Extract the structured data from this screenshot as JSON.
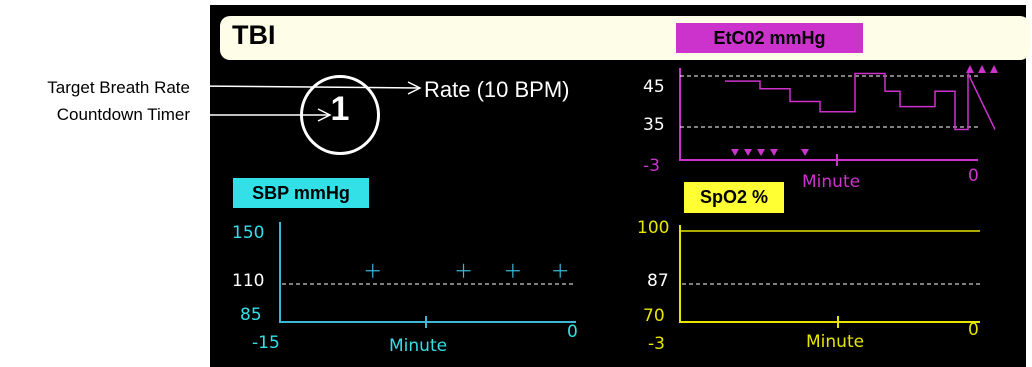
{
  "annotations": {
    "target_breath_rate": "Target Breath Rate",
    "countdown_timer": "Countdown Timer"
  },
  "monitor": {
    "title": "TBI",
    "rate_label": "Rate (10 BPM)",
    "countdown_value": "1"
  },
  "colors": {
    "etco2": "#cc33cc",
    "etco2_badge": "#cc33cc",
    "sbp": "#3cb8d6",
    "sbp_badge": "#33e0e8",
    "spo2": "#e6e600",
    "spo2_badge": "#ffff33",
    "grid": "#ffffff",
    "background": "#000000",
    "header": "#fdfde8"
  },
  "chart_data": [
    {
      "type": "line",
      "title": "EtC02 mmHg",
      "xlabel": "Minute",
      "x_ticks": [
        "-3",
        "0"
      ],
      "y_ticks": [
        "45",
        "35"
      ],
      "reference_lines": [
        45,
        35
      ],
      "series": [
        {
          "x": [
            -2.55,
            -2.2,
            -2.2,
            -1.9,
            -1.9,
            -1.6,
            -1.6,
            -1.25,
            -1.25,
            -0.95,
            -0.95,
            -0.8,
            -0.8,
            -0.45,
            -0.45,
            -0.25,
            -0.25,
            -0.12,
            -0.12,
            0.15
          ],
          "y": [
            44,
            44,
            42.5,
            42.5,
            40,
            40,
            38,
            38,
            45.5,
            45.5,
            42,
            42,
            39,
            39,
            42,
            42,
            34.5,
            34.5,
            45.5,
            34.5
          ]
        }
      ],
      "markers_low_x": [
        -2.45,
        -2.32,
        -2.19,
        -2.06,
        -1.75
      ],
      "markers_high_x": [
        -0.1,
        0.02,
        0.14
      ]
    },
    {
      "type": "scatter",
      "title": "SBP mmHg",
      "xlabel": "Minute",
      "x_ticks": [
        "-15",
        "0"
      ],
      "y_ticks": [
        "150",
        "110",
        "85"
      ],
      "reference_lines": [
        110
      ],
      "series": [
        {
          "x": [
            -10.3,
            -5.7,
            -3.2,
            -0.8
          ],
          "y": [
            119,
            119,
            119,
            119
          ]
        }
      ]
    },
    {
      "type": "line",
      "title": "SpO2 %",
      "xlabel": "Minute",
      "x_ticks": [
        "-3",
        "0"
      ],
      "y_ticks": [
        "100",
        "87",
        "70"
      ],
      "reference_lines": [
        87
      ],
      "series": [
        {
          "x": [
            -3,
            0
          ],
          "y": [
            100,
            100
          ]
        }
      ]
    }
  ]
}
